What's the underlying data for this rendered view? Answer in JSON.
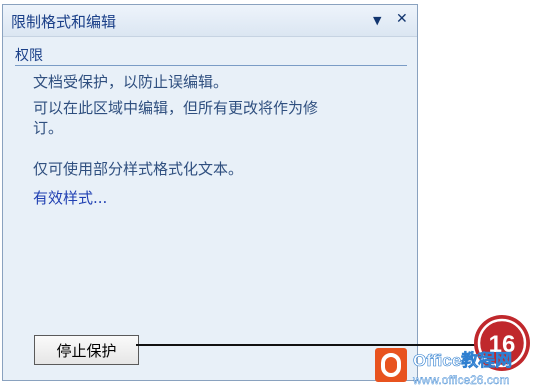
{
  "pane": {
    "title": "限制格式和编辑",
    "dropdown_glyph": "▼",
    "close_glyph": "✕"
  },
  "section": {
    "heading": "权限"
  },
  "body": {
    "line1": "文档受保护，以防止误编辑。",
    "line2": "可以在此区域中编辑，但所有更改将作为修",
    "line3": "订。",
    "line4": "仅可使用部分样式格式化文本。",
    "link": "有效样式..."
  },
  "buttons": {
    "stop_protection": "停止保护"
  },
  "callout": {
    "number": "16"
  },
  "watermark": {
    "brand": "Office教程网",
    "url": "www.office26.com"
  },
  "icons": [
    "chevron-down-icon",
    "close-icon",
    "office-logo-icon"
  ],
  "colors": {
    "title_text": "#1a3f88",
    "body_text": "#2f4f7f",
    "link_text": "#1f3fb2",
    "pane_bg": "#e8f0f8",
    "badge_red": "#c0282c",
    "brand_orange": "#e8531f"
  }
}
